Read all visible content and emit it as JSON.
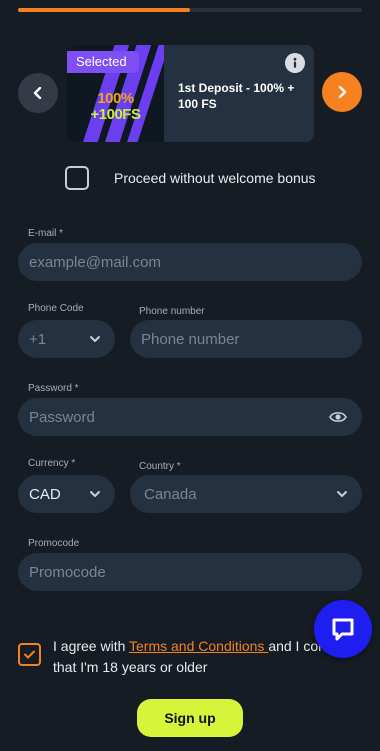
{
  "progress": {
    "fraction": 0.5
  },
  "bonus": {
    "badge": "Selected",
    "image_line1": "100%",
    "image_line2": "+100FS",
    "title": "1st Deposit - 100% + 100 FS"
  },
  "no_bonus": {
    "label": "Proceed without welcome bonus",
    "checked": false
  },
  "form": {
    "email": {
      "label": "E-mail *",
      "placeholder": "example@mail.com"
    },
    "phone_code": {
      "label": "Phone Code",
      "placeholder": "+1"
    },
    "phone_number": {
      "label": "Phone number",
      "placeholder": "Phone number"
    },
    "password": {
      "label": "Password *",
      "placeholder": "Password"
    },
    "currency": {
      "label": "Currency *",
      "value": "CAD"
    },
    "country": {
      "label": "Country *",
      "value": "Canada"
    },
    "promocode": {
      "label": "Promocode",
      "placeholder": "Promocode"
    }
  },
  "terms": {
    "prefix": "I agree with ",
    "link": "Terms and Conditions ",
    "suffix": "and I confirm",
    "line2": "that I'm 18 years or older",
    "checked": true
  },
  "signup": {
    "label": "Sign up"
  },
  "colors": {
    "accent": "#f5821f",
    "primary_button": "#d6f43a",
    "chat": "#1e1ef0",
    "badge": "#7d4ff5"
  },
  "icons": {
    "prev": "chevron-left-icon",
    "next": "chevron-right-icon",
    "info": "info-icon",
    "eye": "eye-icon",
    "chat": "chat-icon",
    "check": "check-icon"
  }
}
